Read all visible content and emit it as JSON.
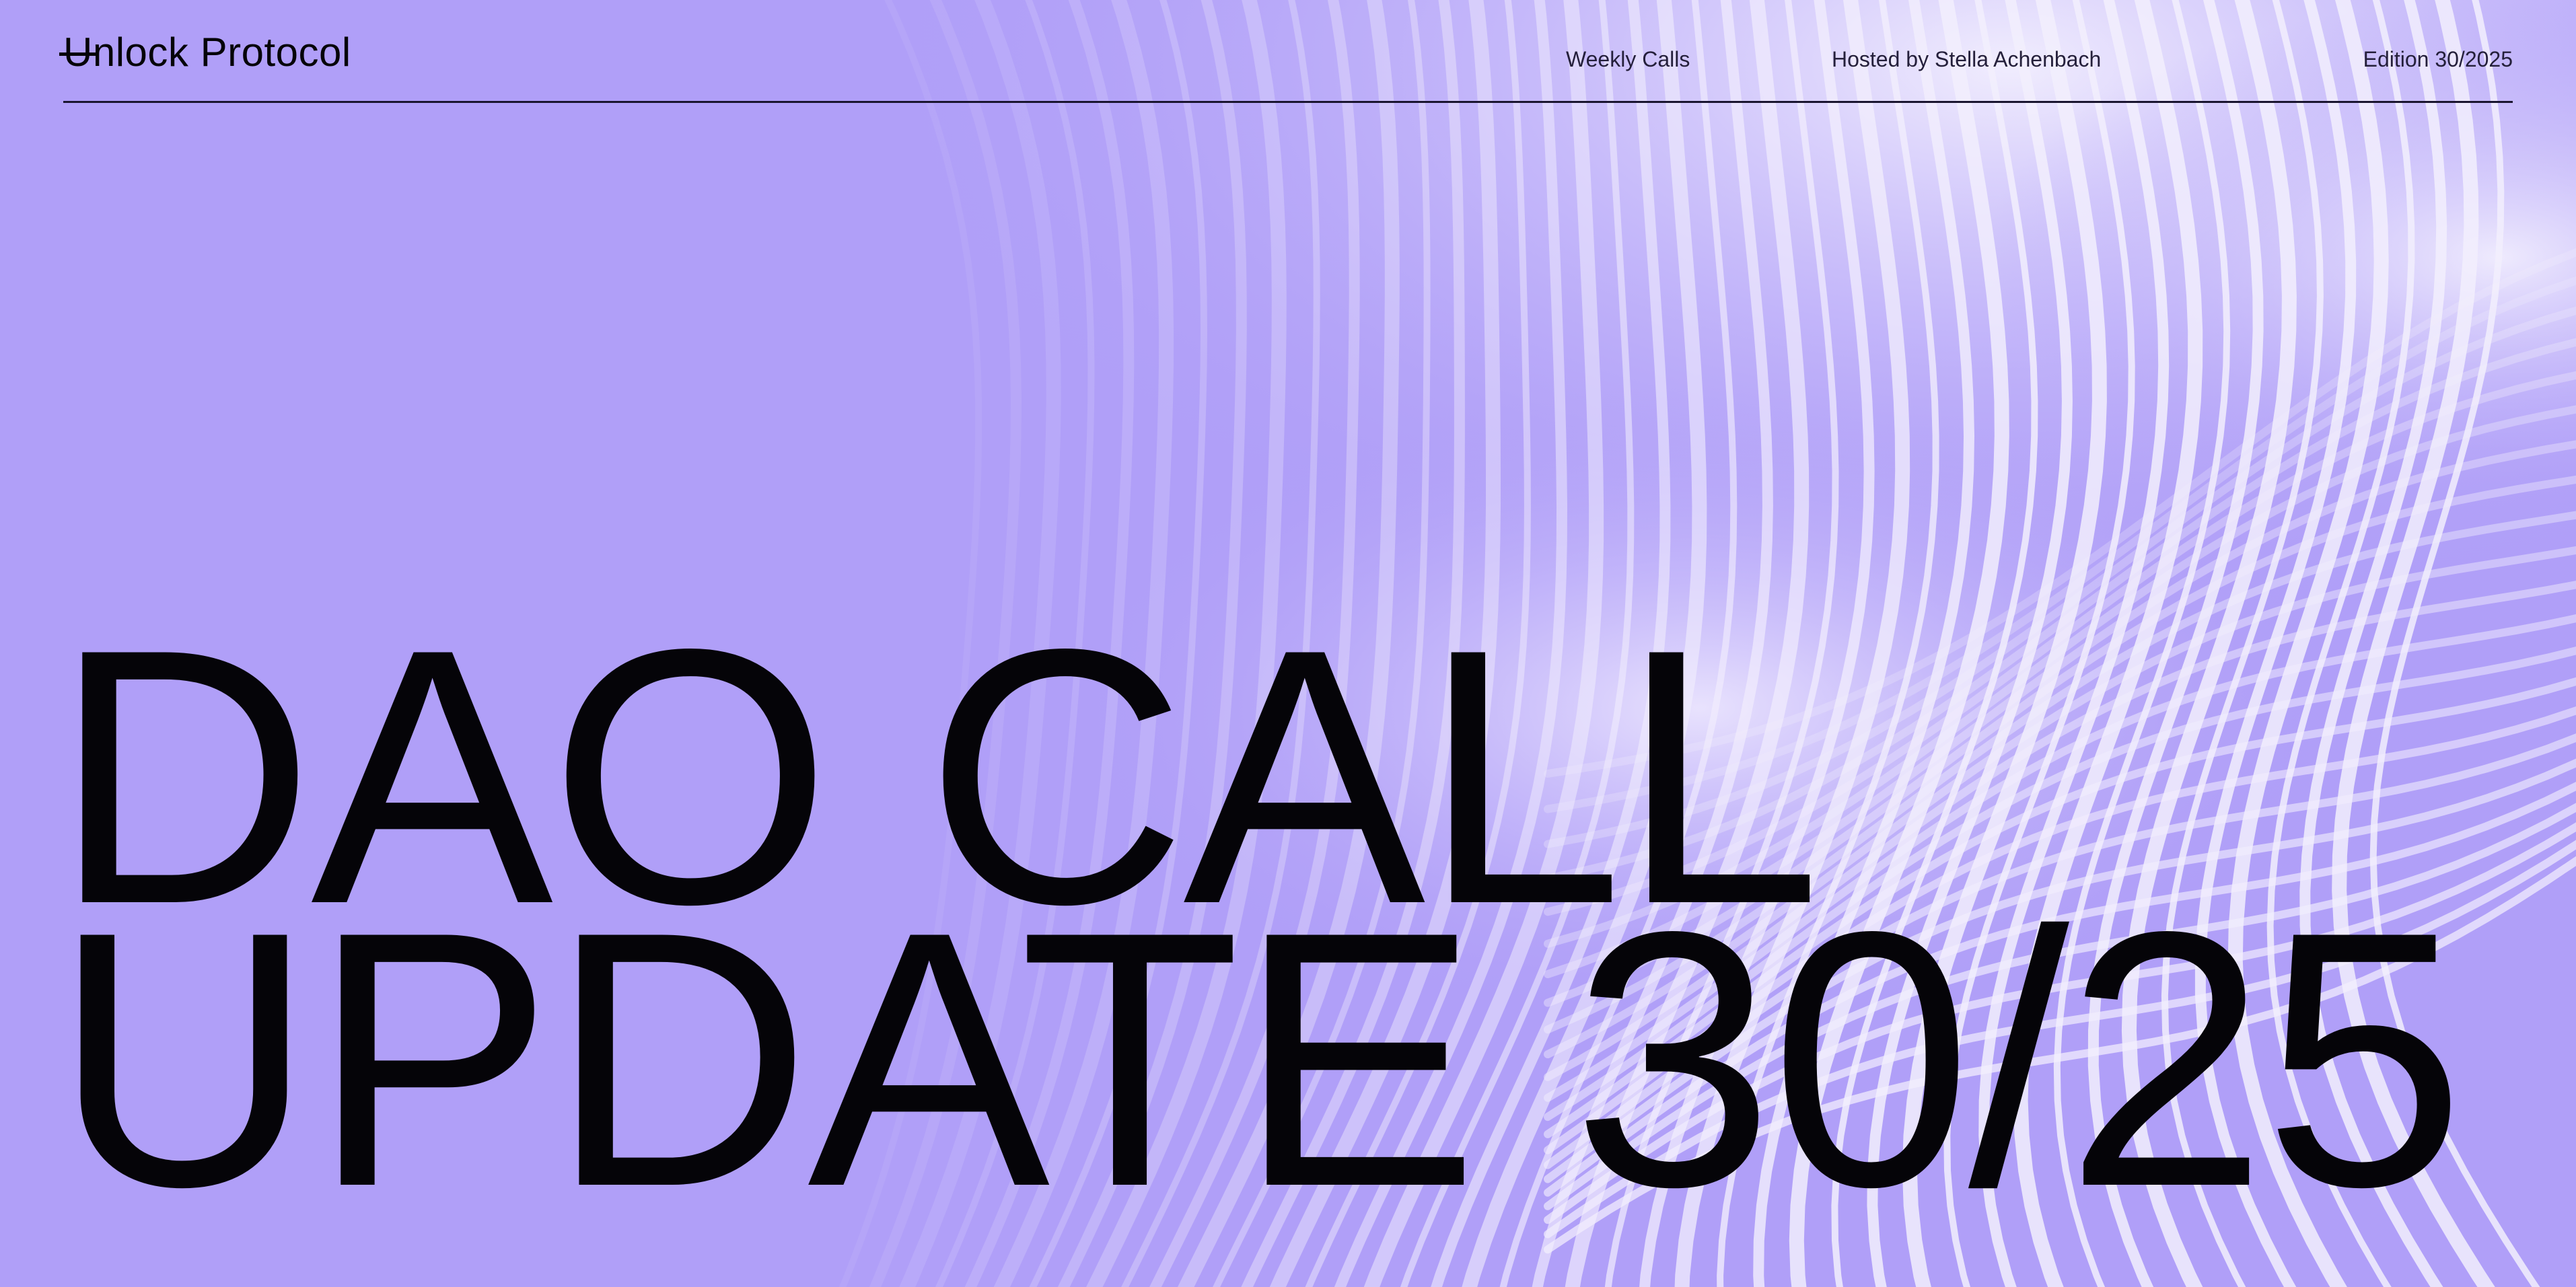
{
  "brand": {
    "mark": "U",
    "rest": "nlock Protocol"
  },
  "nav": {
    "weekly_calls": "Weekly Calls",
    "hosted_by": "Hosted by Stella Achenbach",
    "edition": "Edition 30/2025"
  },
  "headline": {
    "line1": "DAO CALL",
    "line2": "UPDATE 30/25"
  },
  "colors": {
    "background": "#b09ff8",
    "text": "#050408",
    "wave_light": "#f2eefd"
  }
}
